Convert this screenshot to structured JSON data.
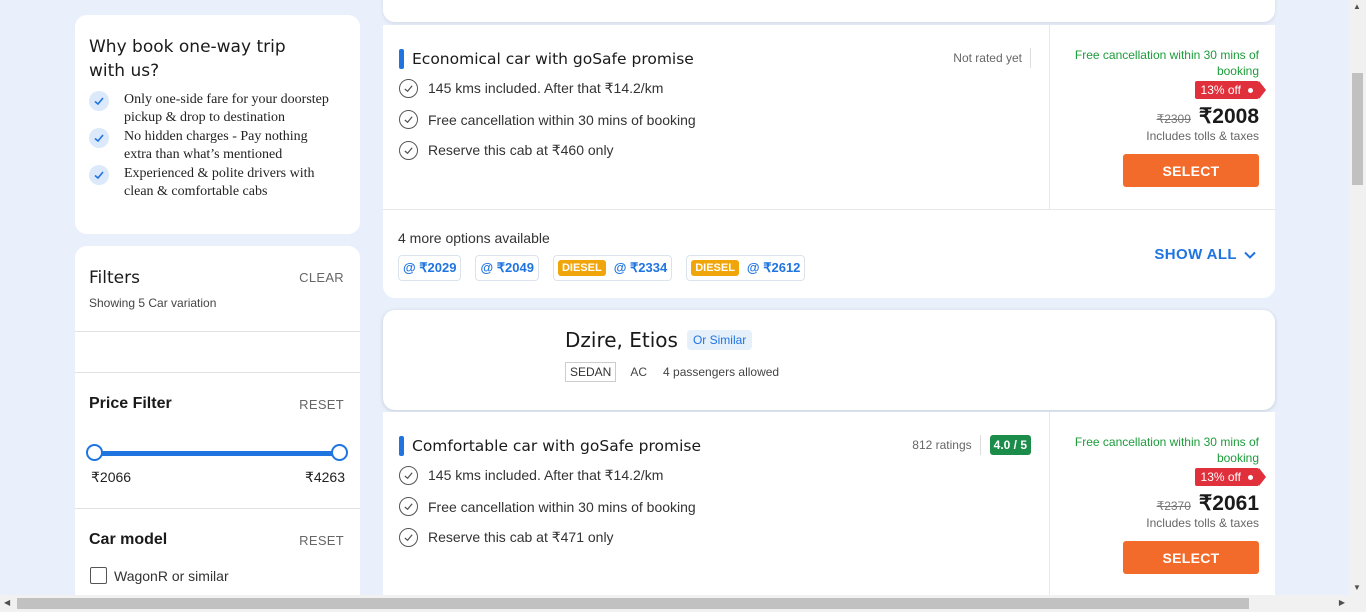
{
  "why_card": {
    "title": "Why book one-way trip with us?",
    "items": [
      "Only one-side fare for your doorstep pickup & drop to destination",
      "No hidden charges - Pay nothing extra than what’s mentioned",
      "Experienced & polite drivers with clean & comfortable cabs"
    ]
  },
  "filters": {
    "title": "Filters",
    "clear_label": "CLEAR",
    "subtitle": "Showing 5 Car variation",
    "price_filter": {
      "title": "Price Filter",
      "reset_label": "RESET",
      "min_label": "₹2066",
      "max_label": "₹4263",
      "range_fraction": [
        0,
        1
      ]
    },
    "car_model": {
      "title": "Car model",
      "reset_label": "RESET",
      "options": [
        "WagonR or similar"
      ]
    }
  },
  "offer1": {
    "title": "Economical car with goSafe promise",
    "rating_text": "Not rated yet",
    "features": [
      "145 kms included. After that ₹14.2/km",
      "Free cancellation within 30 mins of booking",
      "Reserve this cab at ₹460 only"
    ],
    "free_cancel": "Free cancellation within 30 mins of booking",
    "discount": "13% off",
    "old_price": "₹2309",
    "new_price": "₹2008",
    "tolls": "Includes tolls & taxes",
    "select_label": "SELECT",
    "more_title": "4 more options available",
    "chips": [
      {
        "tag": "",
        "price": "@ ₹2029"
      },
      {
        "tag": "",
        "price": "@ ₹2049"
      },
      {
        "tag": "DIESEL",
        "price": "@ ₹2334"
      },
      {
        "tag": "DIESEL",
        "price": "@ ₹2612"
      }
    ],
    "show_all_label": "SHOW ALL"
  },
  "car2": {
    "name": "Dzire, Etios",
    "or_similar": "Or Similar",
    "type": "SEDAN",
    "ac": "AC",
    "passengers": "4 passengers allowed"
  },
  "offer2": {
    "title": "Comfortable car with goSafe promise",
    "rating_text": "812 ratings",
    "rating_badge": "4.0 / 5",
    "features": [
      "145 kms included. After that ₹14.2/km",
      "Free cancellation within 30 mins of booking",
      "Reserve this cab at ₹471 only"
    ],
    "free_cancel": "Free cancellation within 30 mins of booking",
    "discount": "13% off",
    "old_price": "₹2370",
    "new_price": "₹2061",
    "tolls": "Includes tolls & taxes",
    "select_label": "SELECT"
  },
  "colors": {
    "accent_blue": "#1f74e0",
    "select_orange": "#f36b2b",
    "discount_red": "#e0303c",
    "cancel_green": "#1c9c3a",
    "rating_green": "#1c8c4a",
    "diesel_tag": "#f0a50a"
  }
}
